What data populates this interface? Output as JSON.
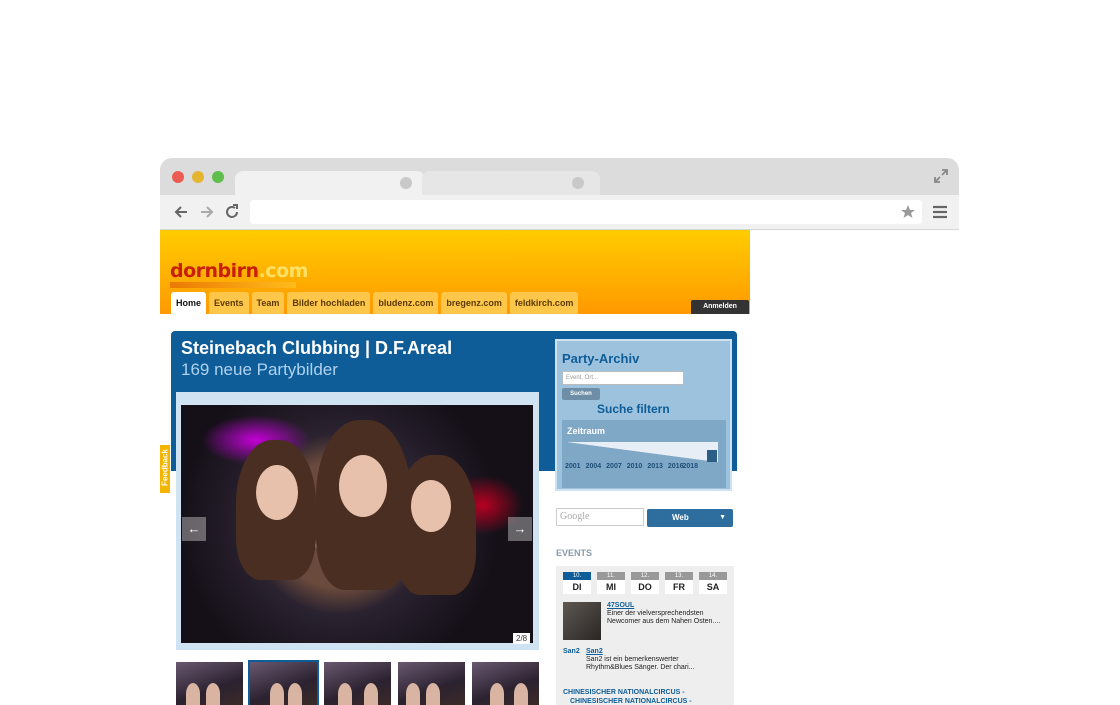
{
  "site": {
    "logo_part1": "dornbirn",
    "logo_part2": ".com",
    "nav": [
      "Home",
      "Events",
      "Team",
      "Bilder hochladen",
      "bludenz.com",
      "bregenz.com",
      "feldkirch.com"
    ],
    "login": "Anmelden",
    "feedback": "Feedback"
  },
  "gallery": {
    "title": "Steinebach Clubbing | D.F.Areal",
    "subtitle": "169 neue Partybilder",
    "counter": "2/8"
  },
  "archive": {
    "title": "Party-Archiv",
    "input_placeholder": "Event, Ort...",
    "search_button": "Suchen",
    "filter_link": "Suche filtern",
    "zeitraum_label": "Zeitraum",
    "years": [
      "2001",
      "2004",
      "2007",
      "2010",
      "2013",
      "2016",
      "2018"
    ],
    "range_position": 1.0
  },
  "google": {
    "placeholder": "Google",
    "button": "Web"
  },
  "events": {
    "heading": "EVENTS",
    "days": [
      {
        "num": "10.",
        "name": "DI"
      },
      {
        "num": "11.",
        "name": "MI"
      },
      {
        "num": "12.",
        "name": "DO"
      },
      {
        "num": "13.",
        "name": "FR"
      },
      {
        "num": "14.",
        "name": "SA"
      }
    ],
    "items": [
      {
        "title": "47SOUL",
        "desc": "Einer der vielversprechendsten Newcomer aus dem Nahen Osten...."
      },
      {
        "prefix": "San2",
        "title": "San2",
        "desc": "San2 ist ein bemerkenswerter Rhythm&Blues Sänger. Der chari..."
      }
    ],
    "third": {
      "line1": "CHINESISCHER NATIONALCIRCUS -",
      "line2": "CHINESISCHER NATIONALCIRCUS -"
    }
  },
  "colors": {
    "accent": "#0e5d98",
    "header": "#ffaa00"
  }
}
